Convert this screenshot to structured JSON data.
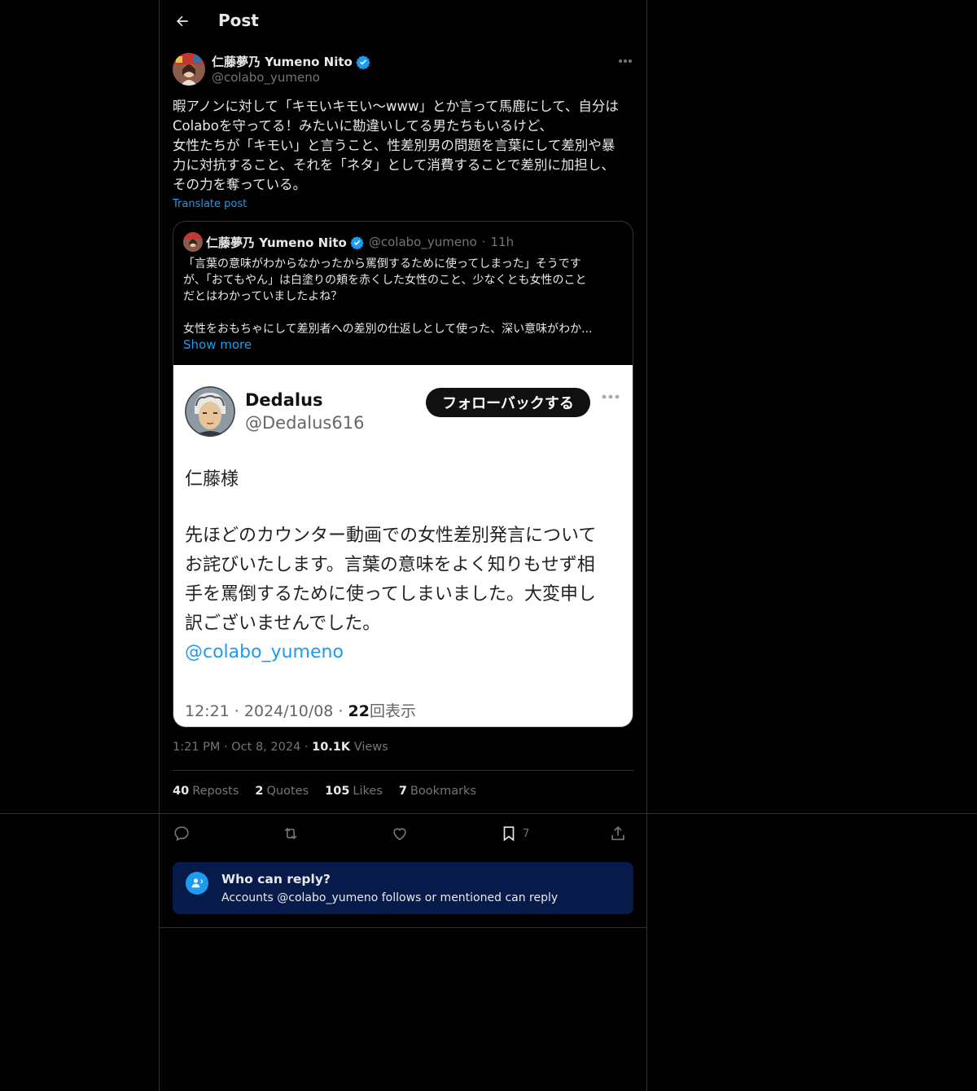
{
  "header": {
    "title": "Post"
  },
  "post": {
    "author_name": "仁藤夢乃 Yumeno Nito",
    "author_handle": "@colabo_yumeno",
    "text": "暇アノンに対して「キモいキモい〜www」とか言って馬鹿にして、自分は\nColaboを守ってる！みたいに勘違いしてる男たちもいるけど、\n女性たちが「キモい」と言うこと、性差別男の問題を言葉にして差別や暴\n力に対抗すること、それを「ネタ」として消費することで差別に加担し、\nその力を奪っている。",
    "translate_label": "Translate post",
    "time": "1:21 PM",
    "date": "Oct 8, 2024",
    "views_count": "10.1K",
    "views_label": "Views",
    "stats": {
      "reposts_count": "40",
      "reposts_label": "Reposts",
      "quotes_count": "2",
      "quotes_label": "Quotes",
      "likes_count": "105",
      "likes_label": "Likes",
      "bookmarks_count": "7",
      "bookmarks_label": "Bookmarks"
    },
    "bookmark_action_count": "7"
  },
  "quote": {
    "author_name": "仁藤夢乃 Yumeno Nito",
    "author_handle": "@colabo_yumeno",
    "age": "11h",
    "text": "「言葉の意味がわからなかったから罵倒するために使ってしまった」そうです\nが、「おてもやん」は白塗りの頬を赤くした女性のこと、少なくとも女性のこと\nだとはわかっていましたよね？\n\n女性をおもちゃにして差別者への差別の仕返しとして使った、深い意味がわか...",
    "show_more": "Show more",
    "screenshot": {
      "name": "Dedalus",
      "handle": "@Dedalus616",
      "follow_label": "フォローバックする",
      "greeting": "仁藤様",
      "body": "先ほどのカウンター動画での女性差別発言について\nお詫びいたします。言葉の意味をよく知りもせず相\n手を罵倒するために使ってしまいました。大変申し\n訳ございませんでした。",
      "mention": "@colabo_yumeno",
      "time": "12:21",
      "date": "2024/10/08",
      "views_count": "22",
      "views_label": "回表示"
    }
  },
  "reply_restriction": {
    "title": "Who can reply?",
    "subtitle": "Accounts @colabo_yumeno follows or mentioned can reply"
  },
  "icons": [
    "back-arrow-icon",
    "verified-badge-icon",
    "more-icon",
    "reply-icon",
    "repost-icon",
    "like-icon",
    "bookmark-icon",
    "share-icon",
    "mention-person-icon"
  ],
  "colors": {
    "background": "#000000",
    "accent": "#1d9bf0",
    "muted": "#71767b",
    "reply_box": "#071b4a",
    "border": "#2f3336"
  }
}
